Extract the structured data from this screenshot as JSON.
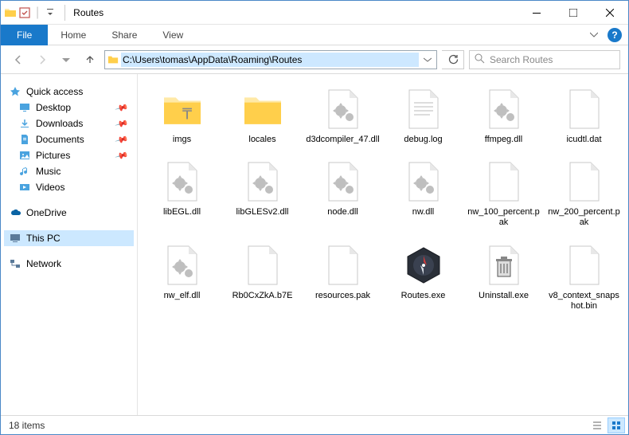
{
  "window": {
    "title": "Routes"
  },
  "ribbon": {
    "file": "File",
    "home": "Home",
    "share": "Share",
    "view": "View"
  },
  "nav": {
    "address": "C:\\Users\\tomas\\AppData\\Roaming\\Routes",
    "search_placeholder": "Search Routes"
  },
  "sidebar": {
    "quick_access": "Quick access",
    "desktop": "Desktop",
    "downloads": "Downloads",
    "documents": "Documents",
    "pictures": "Pictures",
    "music": "Music",
    "videos": "Videos",
    "onedrive": "OneDrive",
    "this_pc": "This PC",
    "network": "Network"
  },
  "files": [
    {
      "name": "imgs",
      "type": "folder-special"
    },
    {
      "name": "locales",
      "type": "folder"
    },
    {
      "name": "d3dcompiler_47.dll",
      "type": "dll"
    },
    {
      "name": "debug.log",
      "type": "text"
    },
    {
      "name": "ffmpeg.dll",
      "type": "dll"
    },
    {
      "name": "icudtl.dat",
      "type": "file"
    },
    {
      "name": "libEGL.dll",
      "type": "dll"
    },
    {
      "name": "libGLESv2.dll",
      "type": "dll"
    },
    {
      "name": "node.dll",
      "type": "dll"
    },
    {
      "name": "nw.dll",
      "type": "dll"
    },
    {
      "name": "nw_100_percent.pak",
      "type": "file"
    },
    {
      "name": "nw_200_percent.pak",
      "type": "file"
    },
    {
      "name": "nw_elf.dll",
      "type": "dll"
    },
    {
      "name": "Rb0CxZkA.b7E",
      "type": "file"
    },
    {
      "name": "resources.pak",
      "type": "file"
    },
    {
      "name": "Routes.exe",
      "type": "compass"
    },
    {
      "name": "Uninstall.exe",
      "type": "trash"
    },
    {
      "name": "v8_context_snapshot.bin",
      "type": "file"
    }
  ],
  "status": {
    "count": "18 items"
  }
}
